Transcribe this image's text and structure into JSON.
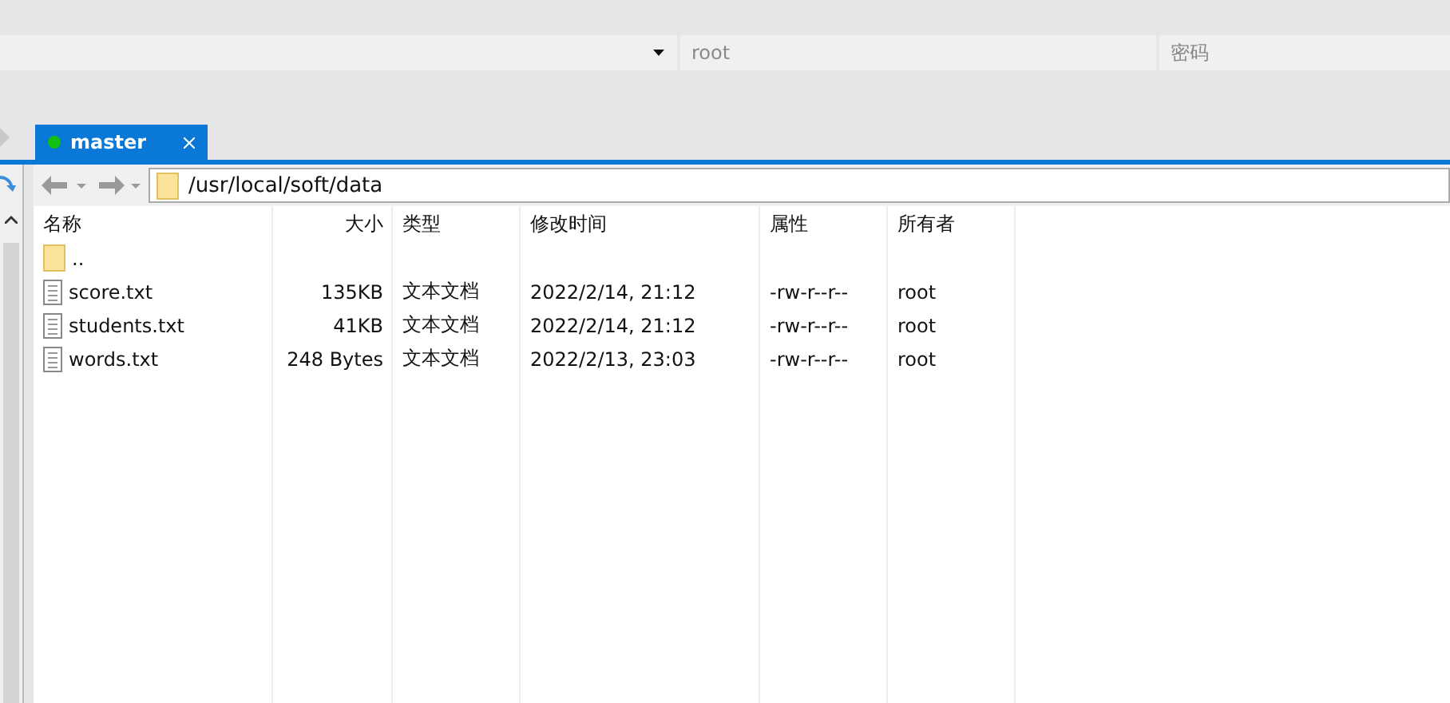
{
  "login_bar": {
    "user_field": {
      "placeholder": "root"
    },
    "password_field": {
      "placeholder": "密码"
    }
  },
  "tabs": [
    {
      "label": "master",
      "connected": true,
      "selected": true
    }
  ],
  "toolbar": {
    "path": "/usr/local/soft/data"
  },
  "table": {
    "columns": [
      "名称",
      "大小",
      "类型",
      "修改时间",
      "属性",
      "所有者"
    ],
    "rows": [
      {
        "kind": "folder",
        "name": ".."
      },
      {
        "kind": "file",
        "name": "score.txt",
        "size": "135KB",
        "type": "文本文档",
        "modified": "2022/2/14, 21:12",
        "attributes": "-rw-r--r--",
        "owner": "root"
      },
      {
        "kind": "file",
        "name": "students.txt",
        "size": "41KB",
        "type": "文本文档",
        "modified": "2022/2/14, 21:12",
        "attributes": "-rw-r--r--",
        "owner": "root"
      },
      {
        "kind": "file",
        "name": "words.txt",
        "size": "248 Bytes",
        "type": "文本文档",
        "modified": "2022/2/13, 23:03",
        "attributes": "-rw-r--r--",
        "owner": "root"
      }
    ]
  }
}
